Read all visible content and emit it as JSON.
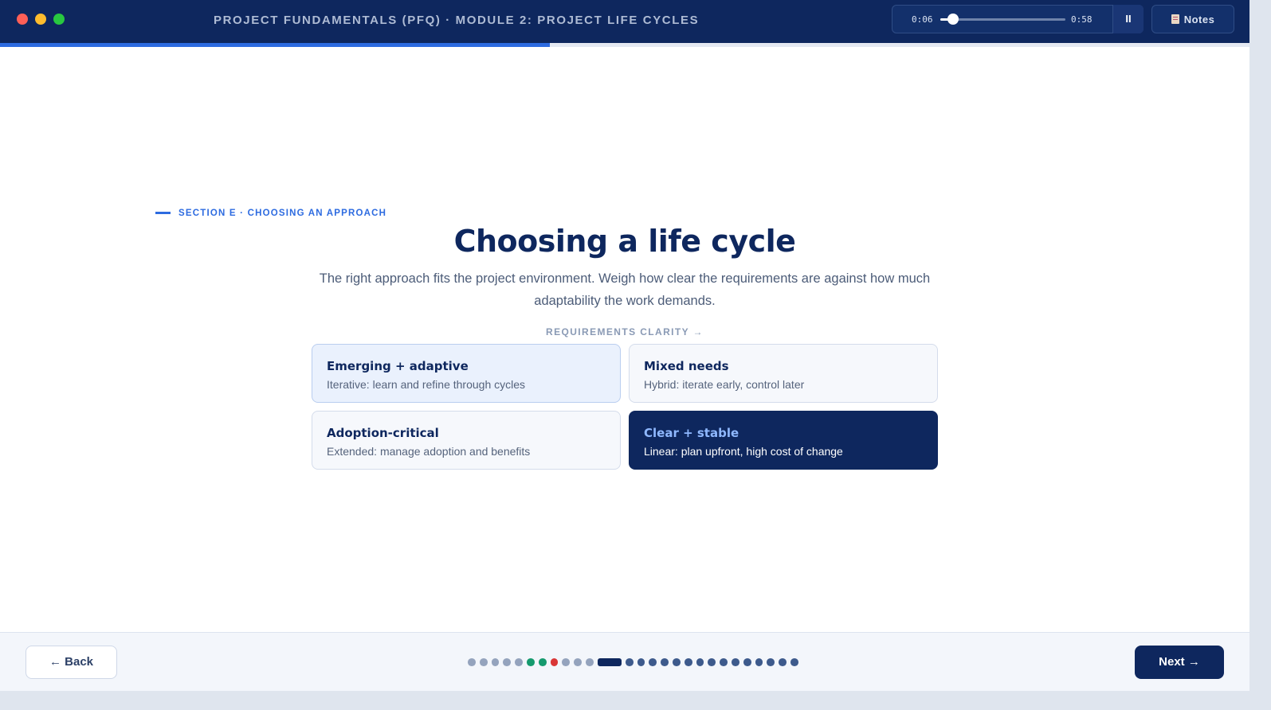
{
  "titlebar": {
    "course_title": "PROJECT FUNDAMENTALS (PFQ) · MODULE 2: PROJECT LIFE CYCLES",
    "player": {
      "current_time": "0:06",
      "total_time": "0:58",
      "playback_fraction": 0.1,
      "pause_label": "II"
    },
    "notes_label": "Notes",
    "course_progress_fraction": 0.44
  },
  "content": {
    "section_label": "SECTION E · CHOOSING AN APPROACH",
    "heading": "Choosing a life cycle",
    "subtitle": "The right approach fits the project environment. Weigh how clear the requirements are against how much adaptability the work demands.",
    "axis_label": "REQUIREMENTS CLARITY →",
    "cards": [
      {
        "title": "Emerging + adaptive",
        "desc": "Iterative: learn and refine through cycles",
        "style": "tint"
      },
      {
        "title": "Mixed needs",
        "desc": "Hybrid: iterate early, control later",
        "style": "plain"
      },
      {
        "title": "Adoption-critical",
        "desc": "Extended: manage adoption and benefits",
        "style": "plain"
      },
      {
        "title": "Clear + stable",
        "desc": "Linear: plan upfront, high cost of change",
        "style": "selected"
      }
    ]
  },
  "footer": {
    "back_label": "← Back",
    "next_label": "Next →",
    "slide_dots": [
      "done",
      "done",
      "done",
      "done",
      "done",
      "correct",
      "correct",
      "wrong",
      "done",
      "done",
      "done",
      "current",
      "upcoming",
      "upcoming",
      "upcoming",
      "upcoming",
      "upcoming",
      "upcoming",
      "upcoming",
      "upcoming",
      "upcoming",
      "upcoming",
      "upcoming",
      "upcoming",
      "upcoming",
      "upcoming",
      "upcoming"
    ]
  },
  "colors": {
    "navy": "#0e275e",
    "accent_blue": "#2d6be0",
    "correct_green": "#159a6e",
    "wrong_red": "#d93636"
  }
}
